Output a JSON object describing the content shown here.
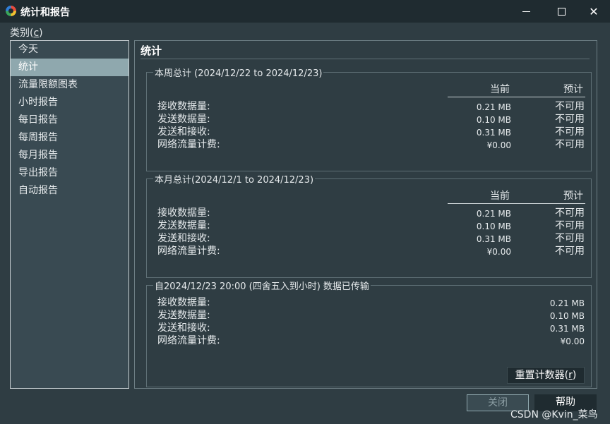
{
  "window": {
    "title": "统计和报告"
  },
  "category": {
    "label": "类别(",
    "accel": "c",
    "label_end": ")",
    "items": [
      "今天",
      "统计",
      "流量限额图表",
      "小时报告",
      "每日报告",
      "每周报告",
      "每月报告",
      "导出报告",
      "自动报告"
    ],
    "selected_index": 1
  },
  "panel": {
    "title": "统计"
  },
  "headers": {
    "current": "当前",
    "forecast": "预计"
  },
  "row_labels": [
    "接收数据量:",
    "发送数据量:",
    "发送和接收:",
    "网络流量计费:"
  ],
  "weekly": {
    "legend": "本周总计 (2024/12/22 to 2024/12/23)",
    "current": [
      "0.21 MB",
      "0.10 MB",
      "0.31 MB",
      "¥0.00"
    ],
    "forecast": [
      "不可用",
      "不可用",
      "不可用",
      "不可用"
    ]
  },
  "monthly": {
    "legend": "本月总计(2024/12/1 to 2024/12/23)",
    "current": [
      "0.21 MB",
      "0.10 MB",
      "0.31 MB",
      "¥0.00"
    ],
    "forecast": [
      "不可用",
      "不可用",
      "不可用",
      "不可用"
    ]
  },
  "since": {
    "legend": "自2024/12/23 20:00 (四舍五入到小时) 数据已传输",
    "values": [
      "0.21 MB",
      "0.10 MB",
      "0.31 MB",
      "¥0.00"
    ]
  },
  "buttons": {
    "reset_label": "重置计数器(",
    "reset_accel": "r",
    "reset_end": ")",
    "close_label": "关闭",
    "help_label": "帮助"
  },
  "watermark": "CSDN @Kvin_菜鸟"
}
